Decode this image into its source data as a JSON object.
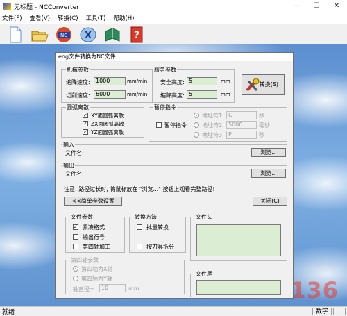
{
  "window": {
    "title": "无标题 - NCConverter",
    "minimize": "—",
    "maximize": "☐",
    "close": "✕"
  },
  "menu": [
    "文件(F)",
    "查看(V)",
    "转换(C)",
    "工具(T)",
    "帮助(H)"
  ],
  "toolbar_icons": [
    "new-file-icon",
    "open-folder-icon",
    "convert-nc-icon",
    "x-tool-icon",
    "book-icon",
    "help-icon"
  ],
  "dialog": {
    "title": "eng文件转换为NC文件",
    "machining": {
      "title": "机械参数",
      "feed_label": "缩降速度:",
      "feed_value": "1000",
      "feed_unit": "mm/min",
      "cut_label": "切削速度:",
      "cut_value": "6000",
      "cut_unit": "mm/min"
    },
    "service": {
      "title": "服务参数",
      "safe_label": "安全高度:",
      "safe_value": "5",
      "safe_unit": "mm",
      "drop_label": "缩降高度:",
      "drop_value": "5",
      "drop_unit": "mm"
    },
    "convert_button": "转换(S)",
    "arc": {
      "title": "圆弧离散",
      "items": [
        "XY面圆弧离散",
        "ZX面圆弧离散",
        "YZ面圆弧离散"
      ]
    },
    "pause": {
      "title": "暂停指令",
      "checkbox": "暂停指令",
      "addr1_label": "地址符1",
      "addr1_value": "G",
      "addr1_unit": "秒",
      "addr2_label": "地址符2",
      "addr2_value": "5000",
      "addr2_unit": "毫秒",
      "addr3_label": "地址符3",
      "addr3_value": "P",
      "addr3_unit": "秒"
    },
    "input": {
      "title": "输入",
      "file_label": "文件名:",
      "browse": "浏览..."
    },
    "output": {
      "title": "输出",
      "file_label": "文件名:",
      "browse": "浏览..."
    },
    "note": "注意: 路径过长时, 将鼠标放在 \"浏览...\" 按钮上观看完整路径!",
    "simple_button": "<<简单参数设置",
    "close_button": "关闭(C)",
    "file_params": {
      "title": "文件参数",
      "items": [
        "紧凑格式",
        "输出行号",
        "第四轴加工"
      ]
    },
    "convert_method": {
      "title": "转换方法",
      "items": [
        "批量转换",
        "按刀具拆分"
      ]
    },
    "file_head": {
      "title": "文件头"
    },
    "file_tail": {
      "title": "文件尾"
    },
    "fourth_axis": {
      "title": "第四轴参数",
      "radio1": "第四轴为X轴",
      "radio2": "第四轴为Y轴",
      "diameter_label": "轴直径=",
      "diameter_value": "10",
      "diameter_unit": "mm"
    }
  },
  "watermark": "644135136",
  "status": {
    "left": "就绪",
    "num": "数字"
  }
}
